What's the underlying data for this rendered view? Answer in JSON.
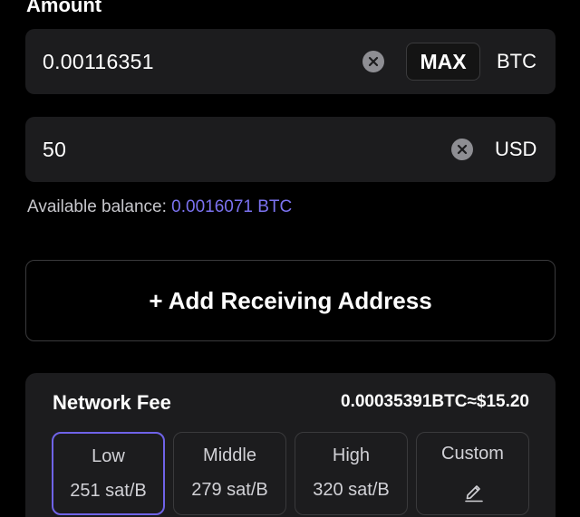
{
  "amount_section": {
    "label": "Amount",
    "btc_field": {
      "value": "0.00116351",
      "max_label": "MAX",
      "unit": "BTC"
    },
    "usd_field": {
      "value": "50",
      "unit": "USD"
    },
    "balance_label": "Available balance:",
    "balance_value": "0.0016071 BTC"
  },
  "add_address": {
    "label": "+ Add Receiving Address"
  },
  "network_fee": {
    "title": "Network Fee",
    "total": "0.00035391BTC≈$15.20",
    "options": [
      {
        "name": "Low",
        "rate": "251 sat/B",
        "selected": true
      },
      {
        "name": "Middle",
        "rate": "279 sat/B",
        "selected": false
      },
      {
        "name": "High",
        "rate": "320 sat/B",
        "selected": false
      },
      {
        "name": "Custom",
        "icon": "edit-pencil-icon",
        "selected": false
      }
    ]
  },
  "colors": {
    "background": "#000000",
    "card": "#1c1c1e",
    "accent": "#7b72f0",
    "selected_border": "#6f63e8"
  }
}
